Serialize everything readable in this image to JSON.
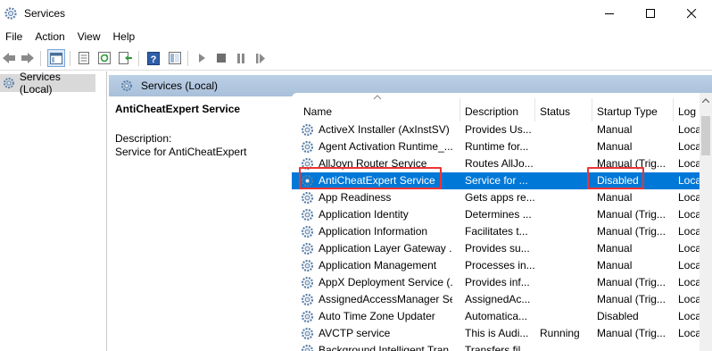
{
  "window": {
    "title": "Services"
  },
  "menu": [
    "File",
    "Action",
    "View",
    "Help"
  ],
  "tree": {
    "selected": "Services (Local)"
  },
  "header_band": {
    "title": "Services (Local)"
  },
  "details": {
    "service_name": "AntiCheatExpert Service",
    "description_label": "Description:",
    "description_value": "Service for AntiCheatExpert"
  },
  "columns": {
    "name": "Name",
    "description": "Description",
    "status": "Status",
    "startup_type": "Startup Type",
    "log_on_as": "Log"
  },
  "rows": [
    {
      "name": "ActiveX Installer (AxInstSV)",
      "description": "Provides Us...",
      "status": "",
      "startup": "Manual",
      "logon": "Loca"
    },
    {
      "name": "Agent Activation Runtime_...",
      "description": "Runtime for...",
      "status": "",
      "startup": "Manual",
      "logon": "Loca"
    },
    {
      "name": "AllJoyn Router Service",
      "description": "Routes AllJo...",
      "status": "",
      "startup": "Manual (Trig...",
      "logon": "Loca"
    },
    {
      "name": "AntiCheatExpert Service",
      "description": "Service for ...",
      "status": "",
      "startup": "Disabled",
      "logon": "Loca"
    },
    {
      "name": "App Readiness",
      "description": "Gets apps re...",
      "status": "",
      "startup": "Manual",
      "logon": "Loca"
    },
    {
      "name": "Application Identity",
      "description": "Determines ...",
      "status": "",
      "startup": "Manual (Trig...",
      "logon": "Loca"
    },
    {
      "name": "Application Information",
      "description": "Facilitates t...",
      "status": "",
      "startup": "Manual (Trig...",
      "logon": "Loca"
    },
    {
      "name": "Application Layer Gateway ...",
      "description": "Provides su...",
      "status": "",
      "startup": "Manual",
      "logon": "Loca"
    },
    {
      "name": "Application Management",
      "description": "Processes in...",
      "status": "",
      "startup": "Manual",
      "logon": "Loca"
    },
    {
      "name": "AppX Deployment Service (...",
      "description": "Provides inf...",
      "status": "",
      "startup": "Manual (Trig...",
      "logon": "Loca"
    },
    {
      "name": "AssignedAccessManager Se...",
      "description": "AssignedAc...",
      "status": "",
      "startup": "Manual (Trig...",
      "logon": "Loca"
    },
    {
      "name": "Auto Time Zone Updater",
      "description": "Automatica...",
      "status": "",
      "startup": "Disabled",
      "logon": "Loca"
    },
    {
      "name": "AVCTP service",
      "description": "This is Audi...",
      "status": "Running",
      "startup": "Manual (Trig...",
      "logon": "Loca"
    },
    {
      "name": "Background Intelligent Tran...",
      "description": "Transfers fil...",
      "status": "",
      "startup": "",
      "logon": ""
    }
  ],
  "selected_row_index": 3,
  "colors": {
    "selection": "#0078d7",
    "highlight_box": "#e33333",
    "header_band": "#b3c8e0"
  }
}
